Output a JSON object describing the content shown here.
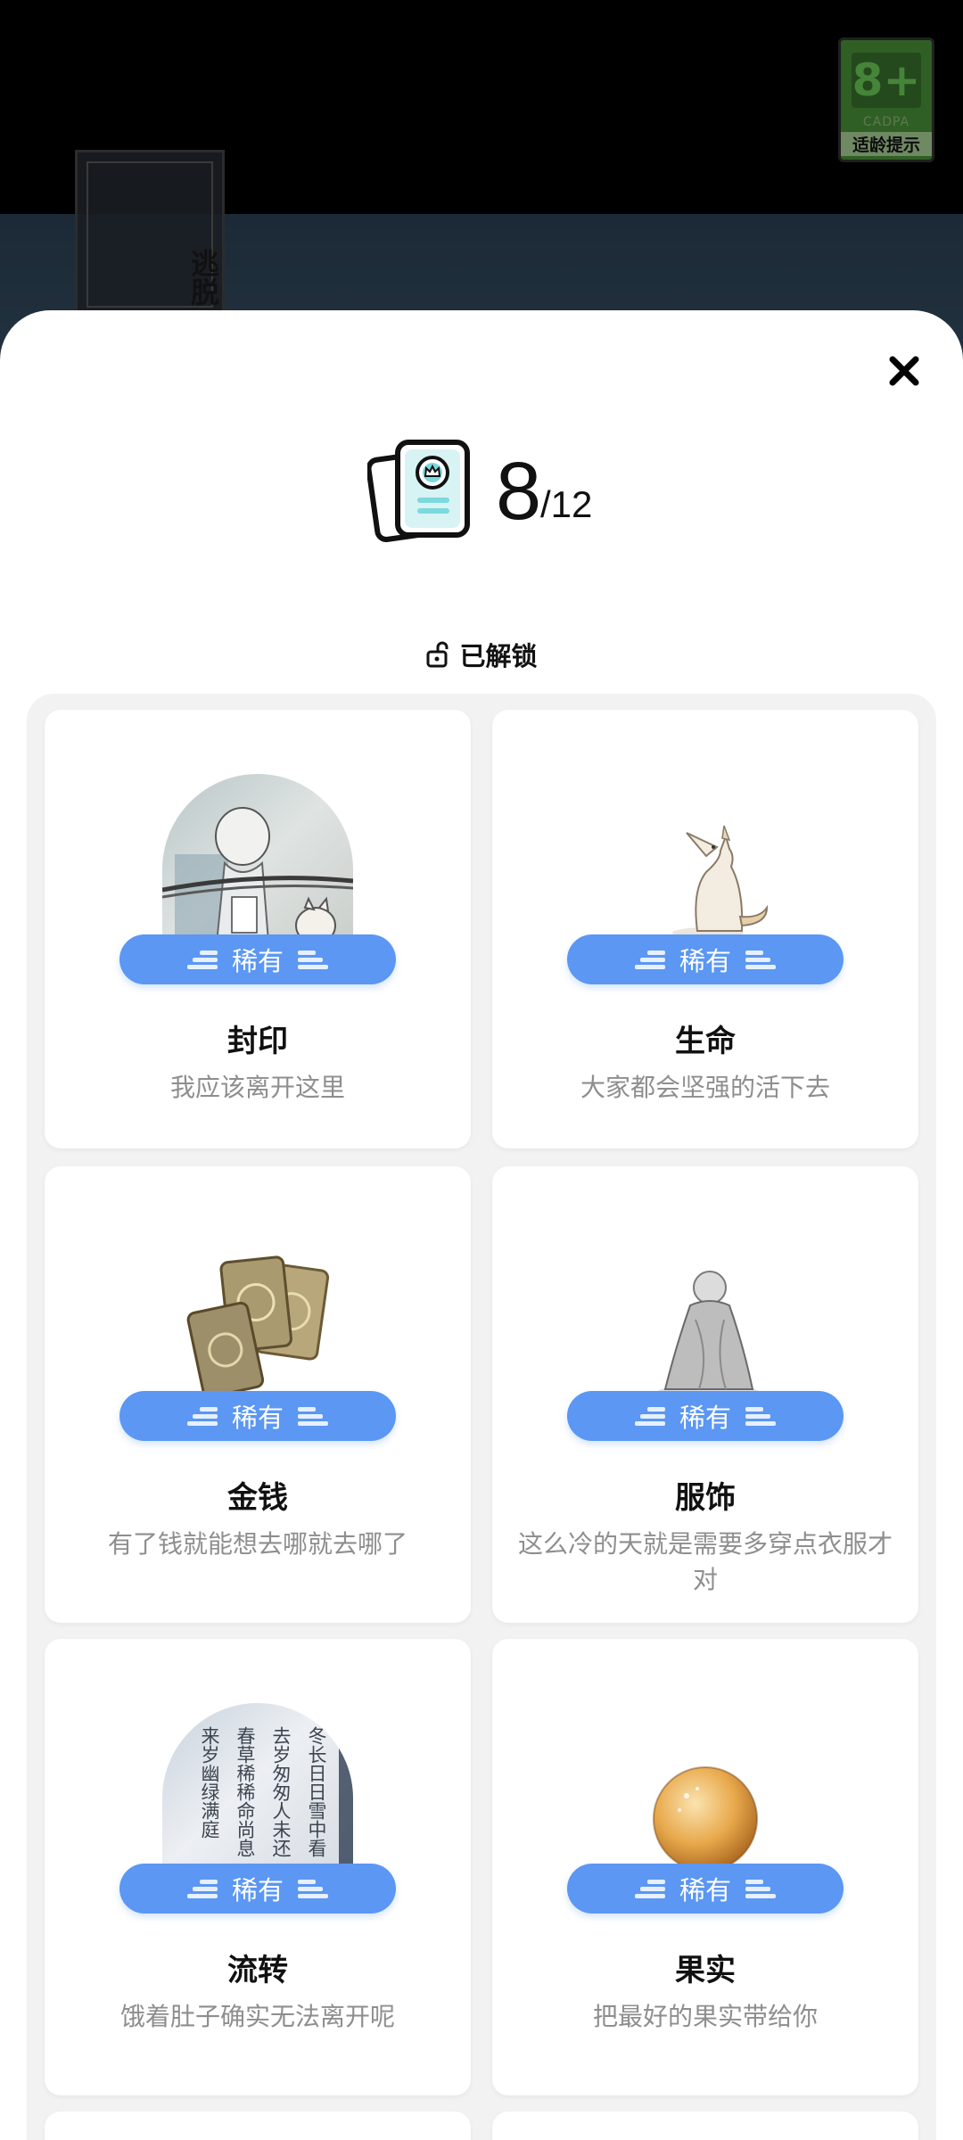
{
  "background": {
    "escape_label": "逃脱",
    "age_badge": {
      "rating": "8+",
      "org": "CADPA",
      "tip": "适龄提示"
    }
  },
  "counter": {
    "unlocked": "8",
    "total": "/12"
  },
  "section": {
    "label": "已解锁"
  },
  "cards": [
    {
      "rarity": "稀有",
      "title": "封印",
      "desc": "我应该离开这里",
      "image": "sealed-figure-image"
    },
    {
      "rarity": "稀有",
      "title": "生命",
      "desc": "大家都会坚强的活下去",
      "image": "fox-image"
    },
    {
      "rarity": "稀有",
      "title": "金钱",
      "desc": "有了钱就能想去哪就去哪了",
      "image": "gold-coins-image"
    },
    {
      "rarity": "稀有",
      "title": "服饰",
      "desc": "这么冷的天就是需要多穿点衣服才对",
      "image": "robed-figure-image"
    },
    {
      "rarity": "稀有",
      "title": "流转",
      "desc": "饿着肚子确实无法离开呢",
      "image": "poem-scroll-image",
      "poem_lines": [
        "冬长日日雪中看",
        "去岁匆匆人未还",
        "春草稀稀命尚息",
        "来岁幽绿满庭"
      ]
    },
    {
      "rarity": "稀有",
      "title": "果实",
      "desc": "把最好的果实带给你",
      "image": "fruit-image"
    }
  ],
  "colors": {
    "badge_blue": "#5b97f3",
    "sheet": "#ffffff",
    "grid_bg": "#f2f2f3"
  }
}
